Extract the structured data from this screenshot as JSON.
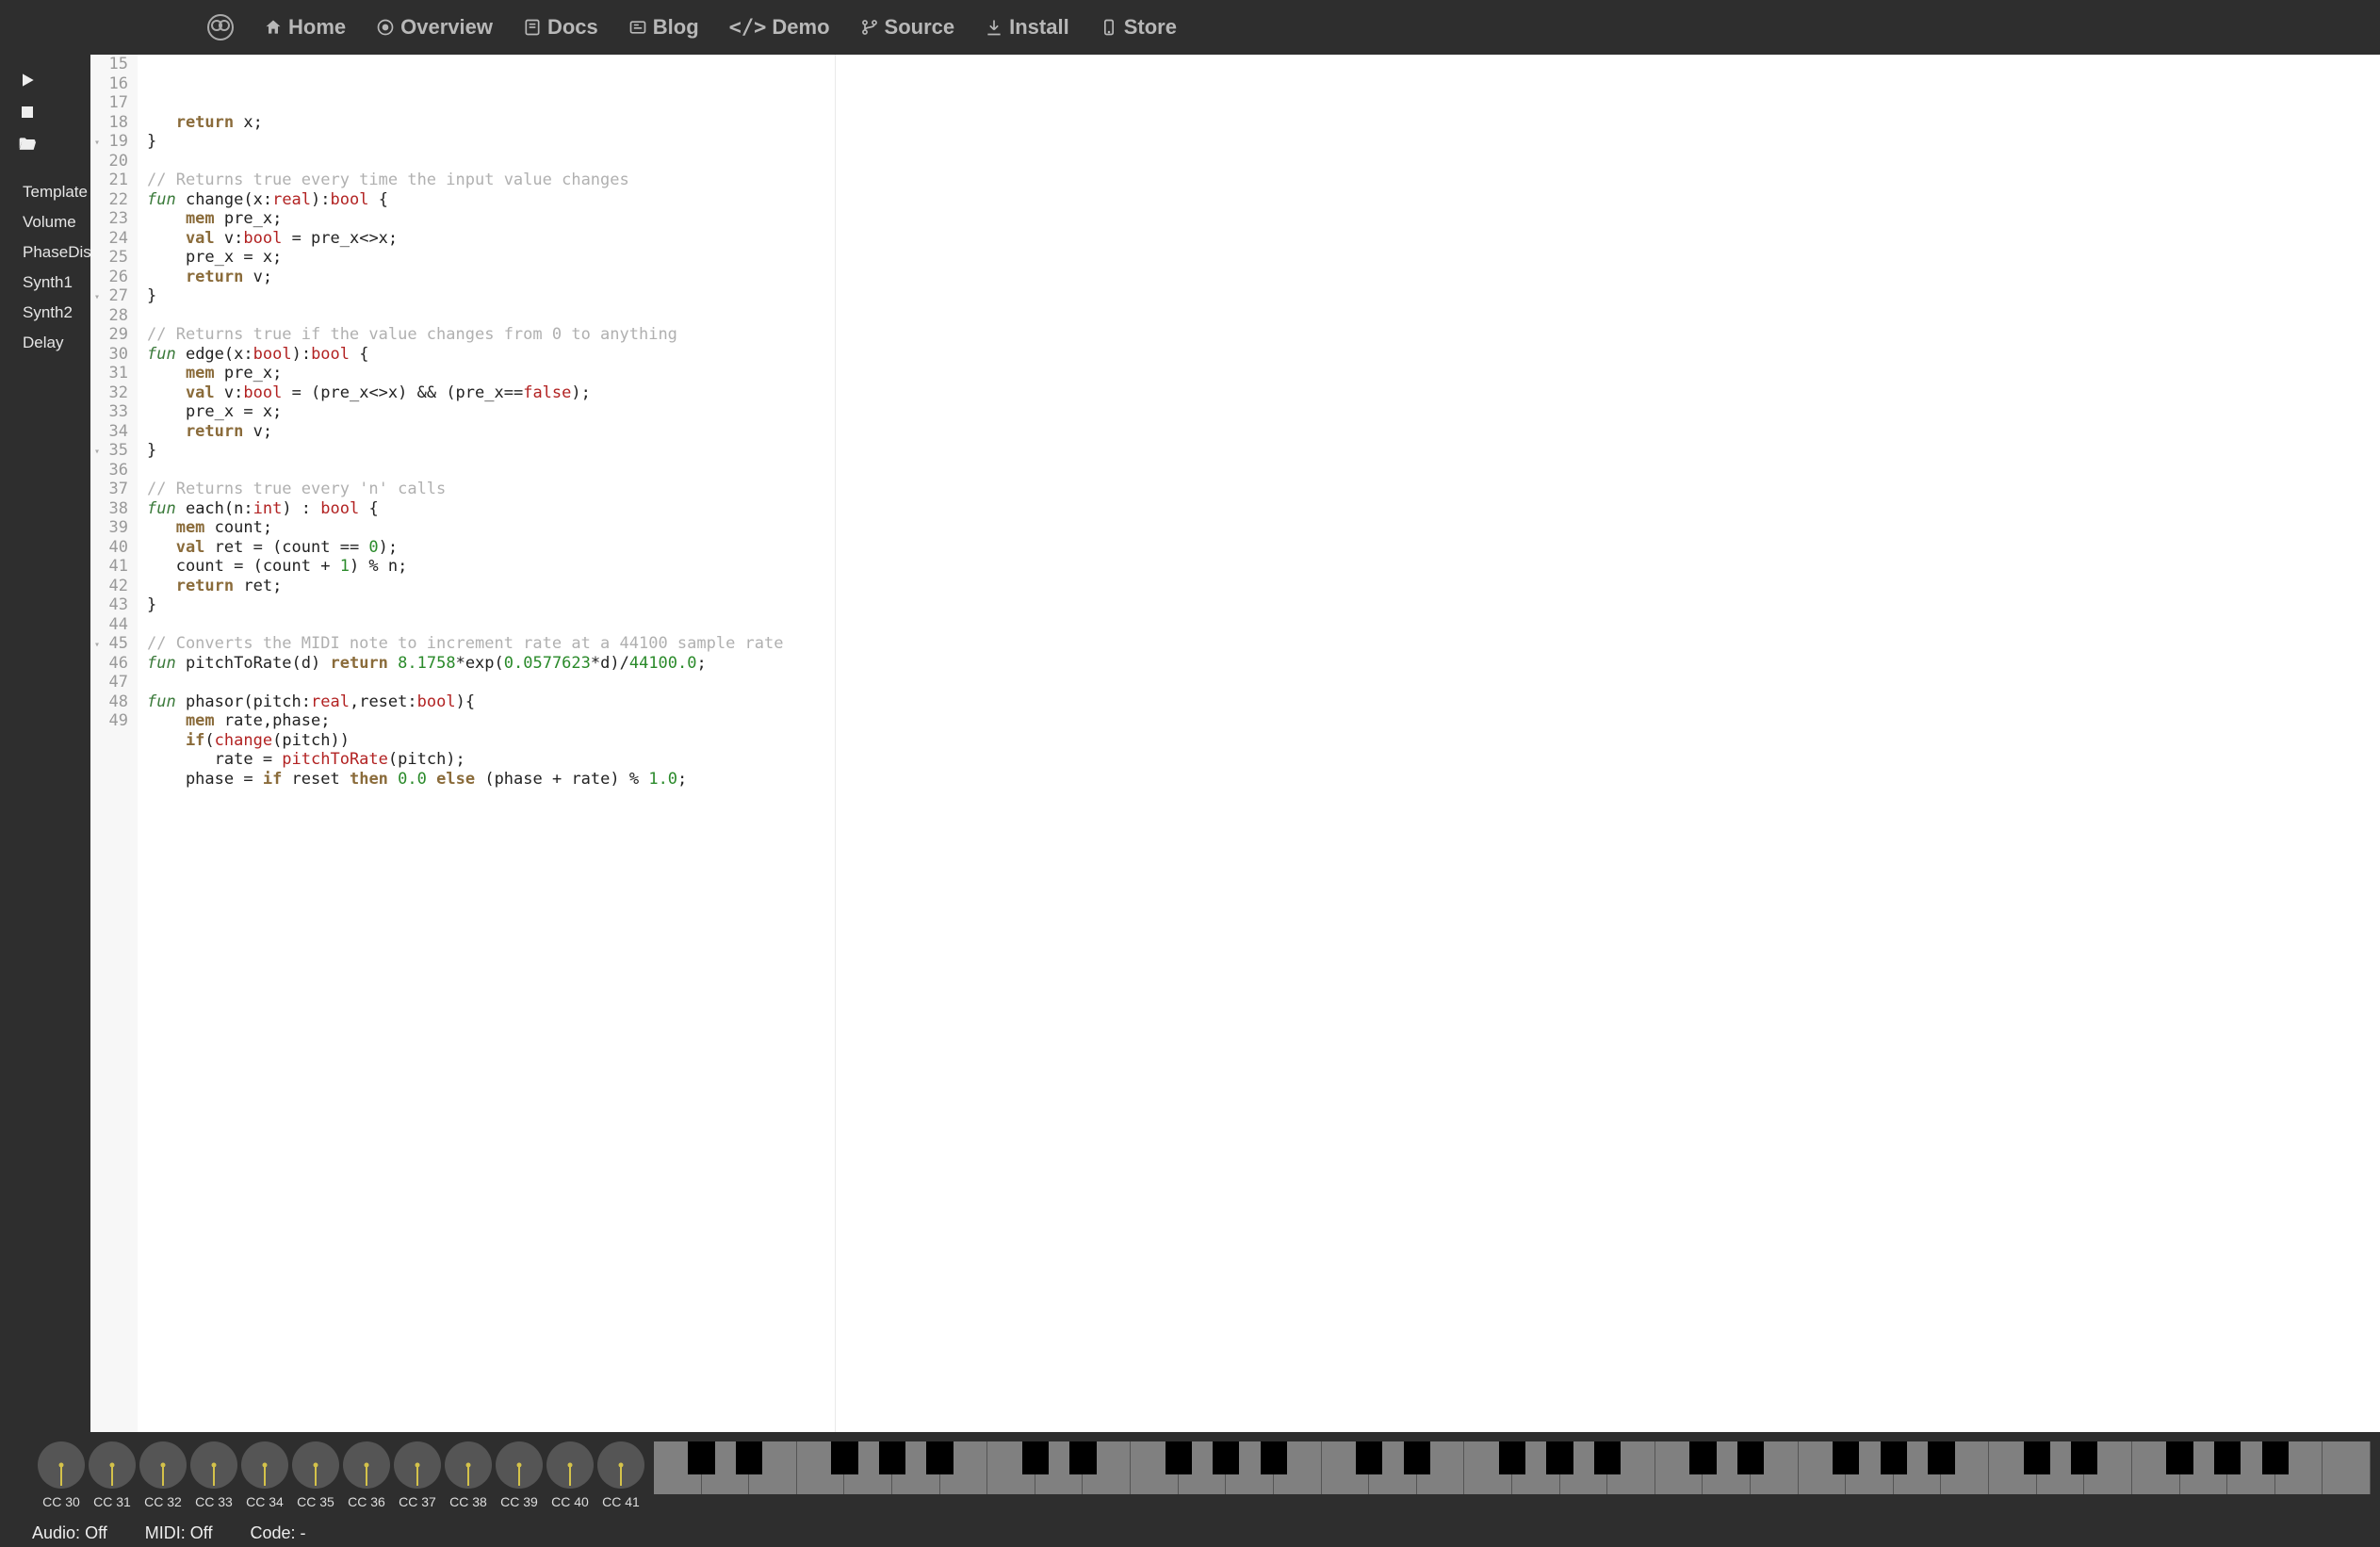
{
  "nav": {
    "home": "Home",
    "overview": "Overview",
    "docs": "Docs",
    "blog": "Blog",
    "demo": "Demo",
    "source": "Source",
    "install": "Install",
    "store": "Store"
  },
  "sidebar": {
    "items": [
      "Template",
      "Volume",
      "PhaseDist",
      "Synth1",
      "Synth2",
      "Delay"
    ]
  },
  "editor": {
    "first_line": 15,
    "fold_lines": [
      19,
      27,
      35,
      45
    ],
    "lines": [
      [
        [
          "kw",
          "   return"
        ],
        [
          "",
          " x;"
        ]
      ],
      [
        [
          "",
          "}"
        ]
      ],
      [
        [
          "",
          ""
        ]
      ],
      [
        [
          "com",
          "// Returns true every time the input value changes"
        ]
      ],
      [
        [
          "fun",
          "fun"
        ],
        [
          "",
          " change(x:"
        ],
        [
          "type",
          "real"
        ],
        [
          "",
          ")"
        ],
        [
          "",
          ":"
        ],
        [
          "type",
          "bool"
        ],
        [
          "",
          " {"
        ]
      ],
      [
        [
          "kw",
          "    mem"
        ],
        [
          "",
          " pre_x;"
        ]
      ],
      [
        [
          "kw",
          "    val"
        ],
        [
          "",
          " v:"
        ],
        [
          "type",
          "bool"
        ],
        [
          "",
          " = pre_x<>x;"
        ]
      ],
      [
        [
          "",
          "    pre_x = x;"
        ]
      ],
      [
        [
          "kw",
          "    return"
        ],
        [
          "",
          " v;"
        ]
      ],
      [
        [
          "",
          "}"
        ]
      ],
      [
        [
          "",
          ""
        ]
      ],
      [
        [
          "com",
          "// Returns true if the value changes from 0 to anything"
        ]
      ],
      [
        [
          "fun",
          "fun"
        ],
        [
          "",
          " edge(x:"
        ],
        [
          "type",
          "bool"
        ],
        [
          "",
          ")"
        ],
        [
          "",
          ":"
        ],
        [
          "type",
          "bool"
        ],
        [
          "",
          " {"
        ]
      ],
      [
        [
          "kw",
          "    mem"
        ],
        [
          "",
          " pre_x;"
        ]
      ],
      [
        [
          "kw",
          "    val"
        ],
        [
          "",
          " v:"
        ],
        [
          "type",
          "bool"
        ],
        [
          "",
          " = (pre_x<>x) && (pre_x=="
        ],
        [
          "type",
          "false"
        ],
        [
          "",
          ");"
        ]
      ],
      [
        [
          "",
          "    pre_x = x;"
        ]
      ],
      [
        [
          "kw",
          "    return"
        ],
        [
          "",
          " v;"
        ]
      ],
      [
        [
          "",
          "}"
        ]
      ],
      [
        [
          "",
          ""
        ]
      ],
      [
        [
          "com",
          "// Returns true every 'n' calls"
        ]
      ],
      [
        [
          "fun",
          "fun"
        ],
        [
          "",
          " each(n:"
        ],
        [
          "type",
          "int"
        ],
        [
          "",
          ") : "
        ],
        [
          "type",
          "bool"
        ],
        [
          "",
          " {"
        ]
      ],
      [
        [
          "kw",
          "   mem"
        ],
        [
          "",
          " count;"
        ]
      ],
      [
        [
          "kw",
          "   val"
        ],
        [
          "",
          " ret = (count == "
        ],
        [
          "num",
          "0"
        ],
        [
          "",
          ");"
        ]
      ],
      [
        [
          "",
          "   count = (count + "
        ],
        [
          "num",
          "1"
        ],
        [
          "",
          ") % n;"
        ]
      ],
      [
        [
          "kw",
          "   return"
        ],
        [
          "",
          " ret;"
        ]
      ],
      [
        [
          "",
          "}"
        ]
      ],
      [
        [
          "",
          ""
        ]
      ],
      [
        [
          "com",
          "// Converts the MIDI note to increment rate at a 44100 sample rate"
        ]
      ],
      [
        [
          "fun",
          "fun"
        ],
        [
          "",
          " pitchToRate(d) "
        ],
        [
          "kw",
          "return"
        ],
        [
          "",
          " "
        ],
        [
          "num",
          "8.1758"
        ],
        [
          "",
          "*exp("
        ],
        [
          "num",
          "0.0577623"
        ],
        [
          "",
          "*d)/"
        ],
        [
          "num",
          "44100.0"
        ],
        [
          "",
          ";"
        ]
      ],
      [
        [
          "",
          ""
        ]
      ],
      [
        [
          "fun",
          "fun"
        ],
        [
          "",
          " phasor(pitch:"
        ],
        [
          "type",
          "real"
        ],
        [
          "",
          ",reset:"
        ],
        [
          "type",
          "bool"
        ],
        [
          "",
          "){"
        ]
      ],
      [
        [
          "kw",
          "    mem"
        ],
        [
          "",
          " rate,phase;"
        ]
      ],
      [
        [
          "kw",
          "    if"
        ],
        [
          "",
          "("
        ],
        [
          "call",
          "change"
        ],
        [
          "",
          "(pitch))"
        ]
      ],
      [
        [
          "",
          "       rate = "
        ],
        [
          "call",
          "pitchToRate"
        ],
        [
          "",
          "(pitch);"
        ]
      ],
      [
        [
          "",
          "    phase = "
        ],
        [
          "kw",
          "if"
        ],
        [
          "",
          " reset "
        ],
        [
          "kw",
          "then"
        ],
        [
          "",
          " "
        ],
        [
          "num",
          "0.0"
        ],
        [
          "",
          " "
        ],
        [
          "kw",
          "else"
        ],
        [
          "",
          " (phase + rate) % "
        ],
        [
          "num",
          "1.0"
        ],
        [
          "",
          ";"
        ]
      ]
    ]
  },
  "knobs": [
    "CC 30",
    "CC 31",
    "CC 32",
    "CC 33",
    "CC 34",
    "CC 35",
    "CC 36",
    "CC 37",
    "CC 38",
    "CC 39",
    "CC 40",
    "CC 41"
  ],
  "status": {
    "audio_label": "Audio:",
    "audio_value": "Off",
    "midi_label": "MIDI:",
    "midi_value": "Off",
    "code_label": "Code:",
    "code_value": "-"
  },
  "piano": {
    "white_keys": 36
  }
}
